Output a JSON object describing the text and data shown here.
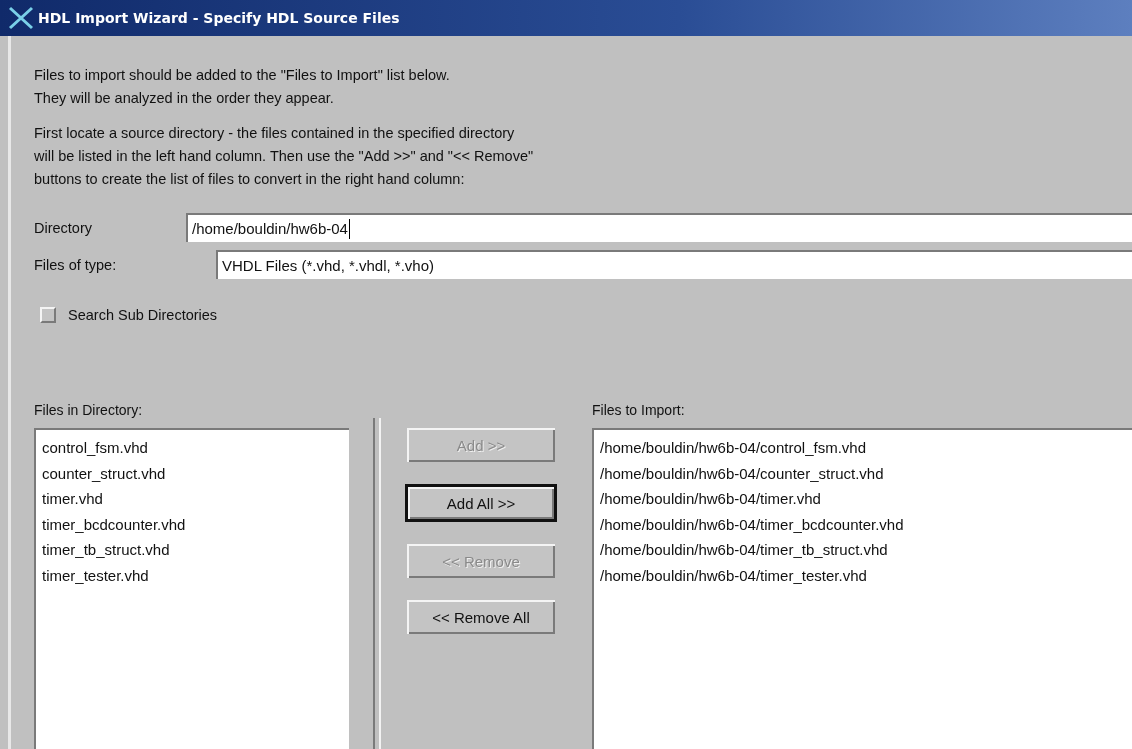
{
  "window": {
    "title": "HDL Import Wizard - Specify HDL Source Files"
  },
  "intro": [
    "Files to import should be added to the \"Files to Import\" list below.",
    "They will be analyzed in the order they appear."
  ],
  "instructions": [
    "First locate a source directory - the files contained in the specified directory",
    "will be listed in the left hand column.  Then use the \"Add >>\" and \"<< Remove\"",
    "buttons to create the list of files to convert in the right hand column:"
  ],
  "directory": {
    "label": "Directory",
    "value": "/home/bouldin/hw6b-04"
  },
  "file_type": {
    "label": "Files of type:",
    "value": "VHDL Files (*.vhd, *.vhdl, *.vho)"
  },
  "search_sub": {
    "label": "Search Sub Directories",
    "checked": false
  },
  "files_in_directory": {
    "label": "Files in Directory:",
    "items": [
      "control_fsm.vhd",
      "counter_struct.vhd",
      "timer.vhd",
      "timer_bcdcounter.vhd",
      "timer_tb_struct.vhd",
      "timer_tester.vhd"
    ]
  },
  "buttons": [
    {
      "label": "Add >>",
      "disabled": true,
      "default": false
    },
    {
      "label": "Add All >>",
      "disabled": false,
      "default": true
    },
    {
      "label": "<< Remove",
      "disabled": true,
      "default": false
    },
    {
      "label": "<< Remove All",
      "disabled": false,
      "default": false
    }
  ],
  "files_to_import": {
    "label": "Files to Import:",
    "items": [
      "/home/bouldin/hw6b-04/control_fsm.vhd",
      "/home/bouldin/hw6b-04/counter_struct.vhd",
      "/home/bouldin/hw6b-04/timer.vhd",
      "/home/bouldin/hw6b-04/timer_bcdcounter.vhd",
      "/home/bouldin/hw6b-04/timer_tb_struct.vhd",
      "/home/bouldin/hw6b-04/timer_tester.vhd"
    ]
  }
}
